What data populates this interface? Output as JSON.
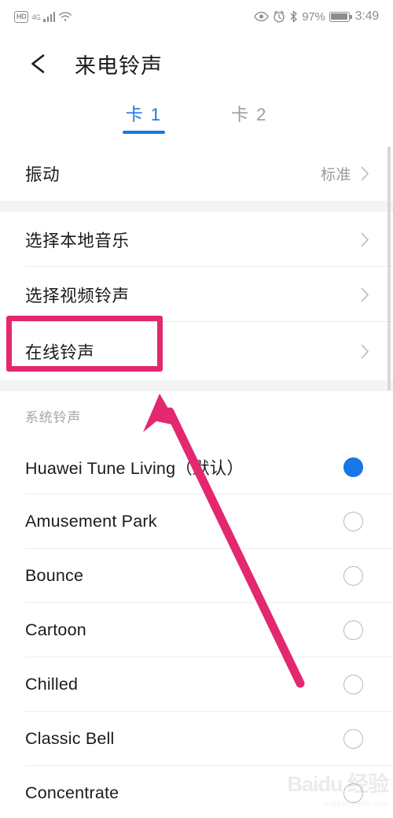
{
  "statusbar": {
    "hd_label": "HD",
    "network_gen": "4G",
    "battery_percent": "97%",
    "clock": "3:49",
    "icons": [
      "hd-badge",
      "signal-bars-icon",
      "wifi-icon",
      "eye-icon",
      "alarm-clock-icon",
      "bluetooth-icon",
      "battery-icon"
    ]
  },
  "header": {
    "back_icon": "back-arrow-icon",
    "title": "来电铃声"
  },
  "tabs": [
    {
      "label": "卡 1",
      "active": true
    },
    {
      "label": "卡 2",
      "active": false
    }
  ],
  "vibration": {
    "label": "振动",
    "value": "标准"
  },
  "menu_rows": [
    {
      "label": "选择本地音乐",
      "highlighted": false
    },
    {
      "label": "选择视频铃声",
      "highlighted": false
    },
    {
      "label": "在线铃声",
      "highlighted": true
    }
  ],
  "system_section": {
    "header": "系统铃声",
    "ringtones": [
      {
        "label": "Huawei Tune Living（默认）",
        "selected": true
      },
      {
        "label": "Amusement Park",
        "selected": false
      },
      {
        "label": "Bounce",
        "selected": false
      },
      {
        "label": "Cartoon",
        "selected": false
      },
      {
        "label": "Chilled",
        "selected": false
      },
      {
        "label": "Classic Bell",
        "selected": false
      },
      {
        "label": "Concentrate",
        "selected": false
      }
    ]
  },
  "annotation": {
    "highlight_color": "#e3286f",
    "arrow_color": "#e3286f",
    "target": "在线铃声"
  },
  "watermark": {
    "text": "Baidu 经验",
    "sub": "jingyan.baidu.com"
  },
  "colors": {
    "accent_blue": "#1877e6",
    "annotation_pink": "#e3286f",
    "text_primary": "#1b1b1b",
    "text_secondary": "#9b9b9b",
    "divider": "#ececec",
    "gap_bg": "#f4f4f4"
  }
}
